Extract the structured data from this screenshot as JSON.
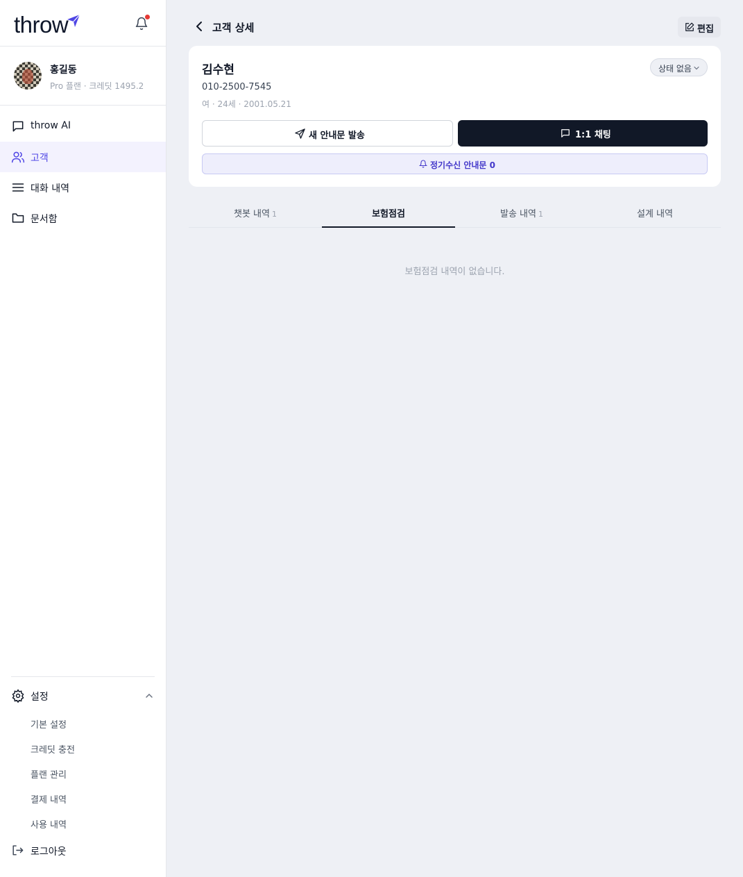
{
  "app": {
    "logo": "throw",
    "brand_color": "#4f46e5"
  },
  "profile": {
    "name": "홍길동",
    "plan": "Pro 플랜 · 크레딧 1495.2"
  },
  "nav": {
    "items": [
      {
        "label": "throw AI",
        "icon": "chat-bubble-icon"
      },
      {
        "label": "고객",
        "icon": "users-icon"
      },
      {
        "label": "대화 내역",
        "icon": "menu-lines-icon"
      },
      {
        "label": "문서함",
        "icon": "folder-icon"
      }
    ]
  },
  "settings": {
    "label": "설정",
    "items": [
      "기본 설정",
      "크레딧 충전",
      "플랜 관리",
      "결제 내역",
      "사용 내역"
    ]
  },
  "logout": "로그아웃",
  "header": {
    "title": "고객 상세",
    "edit_label": "편집"
  },
  "customer": {
    "name": "김수현",
    "phone": "010-2500-7545",
    "info": "여 · 24세 · 2001.05.21",
    "status": "상태 없음"
  },
  "actions": {
    "send_label": "새 안내문 발송",
    "chat_label": "1:1 채팅",
    "subscription_label": "정기수신 안내문 0"
  },
  "tabs": [
    {
      "label": "챗봇 내역",
      "count": "1"
    },
    {
      "label": "보험점검",
      "count": ""
    },
    {
      "label": "발송 내역",
      "count": "1"
    },
    {
      "label": "설계 내역",
      "count": ""
    }
  ],
  "empty_message": "보험점검 내역이 없습니다."
}
